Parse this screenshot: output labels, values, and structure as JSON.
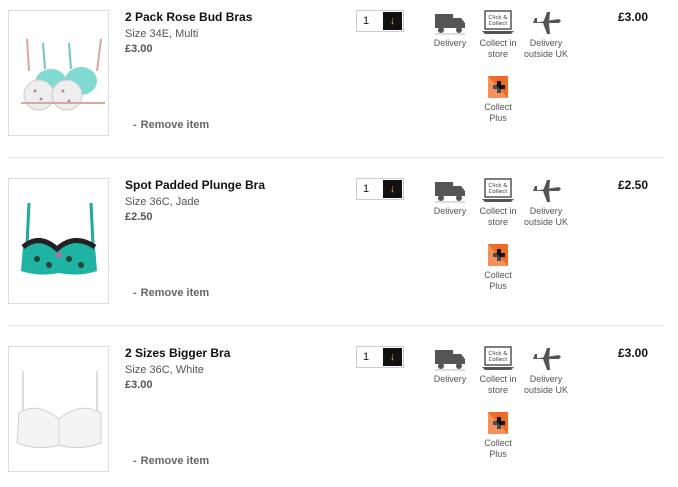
{
  "basket": {
    "items": [
      {
        "name": "2 Pack Rose Bud Bras",
        "variant": "Size 34E, Multi",
        "unit_price": "£3.00",
        "quantity": "1",
        "line_total": "£3.00",
        "remove_label": "Remove item",
        "image": "two-pack-bras-image"
      },
      {
        "name": "Spot Padded Plunge Bra",
        "variant": "Size 36C, Jade",
        "unit_price": "£2.50",
        "quantity": "1",
        "line_total": "£2.50",
        "remove_label": "Remove item",
        "image": "spot-plunge-bra-image"
      },
      {
        "name": "2 Sizes Bigger Bra",
        "variant": "Size 36C, White",
        "unit_price": "£3.00",
        "quantity": "1",
        "line_total": "£3.00",
        "remove_label": "Remove item",
        "image": "white-bra-image"
      }
    ],
    "delivery_options": {
      "delivery": "Delivery",
      "collect_in_store_line1": "Collect in",
      "collect_in_store_line2": "store",
      "outside_uk_line1": "Delivery",
      "outside_uk_line2": "outside UK",
      "collect_plus_line1": "Collect",
      "collect_plus_line2": "Plus",
      "click_collect_badge_line1": "Click &",
      "click_collect_badge_line2": "Collect"
    },
    "icons": {
      "qty_arrow": "down-arrow-icon",
      "delivery": "van-icon",
      "collect_in_store": "laptop-icon",
      "outside_uk": "plane-icon",
      "collect_plus": "plus-icon"
    },
    "colors": {
      "accent": "#f5a623",
      "collect_plus": "#f06b22"
    }
  }
}
